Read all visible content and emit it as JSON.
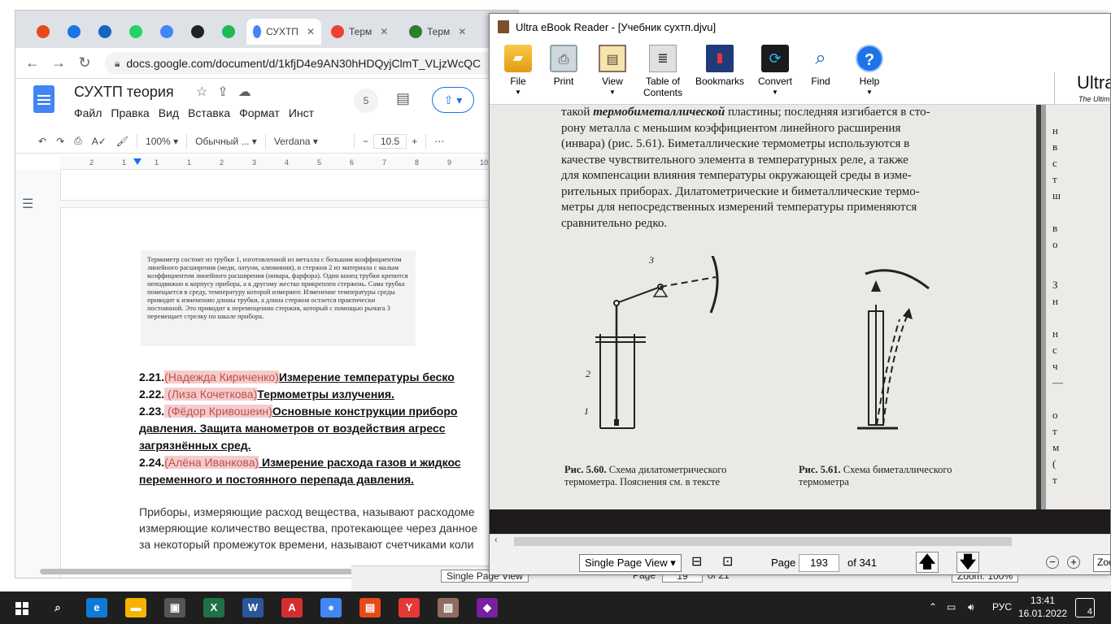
{
  "chrome": {
    "tabs": [
      {
        "label": "",
        "icon": "asterisk-icon",
        "color": "#e64a19"
      },
      {
        "label": "",
        "icon": "chat-icon",
        "color": "#1a73e8"
      },
      {
        "label": "",
        "icon": "mail-icon",
        "color": "#1565c0"
      },
      {
        "label": "",
        "icon": "whatsapp-icon",
        "color": "#25d366"
      },
      {
        "label": "",
        "icon": "translate-icon",
        "color": "#4285f4"
      },
      {
        "label": "",
        "icon": "moodle-icon",
        "color": "#222222"
      },
      {
        "label": "",
        "icon": "spotify-icon",
        "color": "#1db954"
      },
      {
        "label": "СУХТП",
        "icon": "docs-icon",
        "color": "#4285f4"
      },
      {
        "label": "Терм",
        "icon": "google-icon",
        "color": "#ea4335"
      },
      {
        "label": "Терм",
        "icon": "tree-icon",
        "color": "#2e7d32"
      }
    ],
    "url": "docs.google.com/document/d/1kfjD4e9AN30hHDQyjClmT_VLjzWcQC"
  },
  "docs": {
    "title": "СУХТП теория",
    "menu": [
      "Файл",
      "Правка",
      "Вид",
      "Вставка",
      "Формат",
      "Инст"
    ],
    "collab_count": "5",
    "toolbar": {
      "zoom": "100%",
      "style": "Обычный ...",
      "font": "Verdana",
      "font_size": "10.5"
    },
    "ruler_numbers": [
      "2",
      "1",
      "1",
      "1",
      "2",
      "3",
      "4",
      "5",
      "6",
      "7",
      "8",
      "9",
      "10",
      "11"
    ],
    "scan_text": "Термометр состоит из трубки 1, изготовленной из металла с большим коэффициентом линейного расширения (меди, латуни, алюминия), и стержня 2 из материала с малым коэффициентом линейного расширения (инвара, фарфора). Один конец трубки крепится неподвижно к корпусу прибора, а к другому жестко прикреплен стержень. Сама трубка помещается в среду, температуру которой измеряют. Изменение температуры среды приводит к изменению длины трубки, а длина стержня остается практически постоянной. Это приводит к перемещению стержня, который с помощью рычага 3 перемещает стрелку по шкале прибора.",
    "toc": [
      {
        "num": "2.21.",
        "person": "(Надежда Кириченко)",
        "topic": "Измерение температуры беско"
      },
      {
        "num": "2.22.",
        "person": " (Лиза Кочеткова)",
        "topic": "Термометры излучения."
      },
      {
        "num": "2.23.",
        "person": " (Фёдор Кривошеин)",
        "topic": "Основные конструкции приборо"
      },
      {
        "num": "",
        "person": "",
        "topic": "давления. Защита манометров от воздействия агресс"
      },
      {
        "num": "",
        "person": "",
        "topic": "загрязнённых сред."
      },
      {
        "num": "2.24.",
        "person": "(Алёна Иванкова)",
        "topic": " Измерение расхода газов и жидкос"
      },
      {
        "num": "",
        "person": "",
        "topic": "переменного и постоянного перепада давления."
      }
    ],
    "body_lines": [
      "Приборы, измеряющие расход вещества, называют расходоме",
      "измеряющие количество вещества, протекающее через данное",
      "за некоторый промежуток времени, называют счетчиками коли"
    ]
  },
  "background_window": {
    "view": "Single Page View",
    "page_label": "Page",
    "page_value": "19",
    "of": "of 21",
    "zoom": "Zoom: 100%"
  },
  "reader": {
    "title": "Ultra eBook Reader - [Учебник сухтп.djvu]",
    "ribbon": [
      {
        "label": "File",
        "icon": "folder-icon",
        "caret": true
      },
      {
        "label": "Print",
        "icon": "printer-icon",
        "caret": false
      },
      {
        "label": "View",
        "icon": "book-icon",
        "caret": true
      },
      {
        "label": "Table of Contents",
        "icon": "toc-icon",
        "caret": false
      },
      {
        "label": "Bookmarks",
        "icon": "bookmarks-icon",
        "caret": false
      },
      {
        "label": "Convert",
        "icon": "convert-icon",
        "caret": true
      },
      {
        "label": "Find",
        "icon": "magnifier-icon",
        "caret": false
      },
      {
        "label": "Help",
        "icon": "help-icon",
        "caret": true
      }
    ],
    "brand": "Ultra",
    "brand_sub": "The Ultim",
    "page_text": [
      "такой термобиметаллической пластины; последняя изгибается в сто-",
      "рону металла с меньшим коэффициентом линейного расширения",
      "(инвара) (рис. 5.61). Биметаллические термометры используются в",
      "качестве чувствительного элемента в температурных реле, а также",
      "для компенсации влияния температуры окружающей среды в изме-",
      "рительных приборах. Дилатометрические и биметаллические термо-",
      "метры для непосредственных измерений температуры применяются",
      "сравнительно редко."
    ],
    "fig_labels": [
      "3",
      "2",
      "1"
    ],
    "caption_60": {
      "bold": "Рис. 5.60.",
      "text": " Схема дилатометрического термометра. Пояснения см. в тексте"
    },
    "caption_61": {
      "bold": "Рис. 5.61.",
      "text": " Схема биметаллического термометра"
    },
    "right_col": [
      "н",
      "в",
      "с",
      "т",
      "ш",
      "в",
      "о",
      "З",
      "н",
      "н",
      "с",
      "ч",
      "—",
      "о",
      "т",
      "м",
      "(",
      "т"
    ],
    "status": {
      "view_mode": "Single Page View",
      "page_label": "Page",
      "page": "193",
      "of": "of 341",
      "zoom": "Zoc"
    }
  },
  "taskbar": {
    "apps": [
      {
        "icon": "search-icon",
        "label": "⌕",
        "color": "#1f1f1f"
      },
      {
        "icon": "edge-icon",
        "label": "e",
        "color": "#0f7bd6"
      },
      {
        "icon": "explorer-icon",
        "label": "▬",
        "color": "#f4b400"
      },
      {
        "icon": "store-icon",
        "label": "▣",
        "color": "#555555"
      },
      {
        "icon": "excel-icon",
        "label": "X",
        "color": "#1e7145"
      },
      {
        "icon": "word-icon",
        "label": "W",
        "color": "#2b579a"
      },
      {
        "icon": "acrobat-icon",
        "label": "A",
        "color": "#d32f2f"
      },
      {
        "icon": "chrome-icon",
        "label": "●",
        "color": "#4285f4"
      },
      {
        "icon": "presentation-icon",
        "label": "▤",
        "color": "#e64a19"
      },
      {
        "icon": "yandex-icon",
        "label": "Y",
        "color": "#e53935"
      },
      {
        "icon": "ebook-reader-icon",
        "label": "▥",
        "color": "#8d6e63"
      },
      {
        "icon": "paint-icon",
        "label": "◆",
        "color": "#7b1fa2"
      }
    ],
    "tray_lang": "РУС",
    "time": "13:41",
    "date": "16.01.2022",
    "notifications": "4"
  }
}
